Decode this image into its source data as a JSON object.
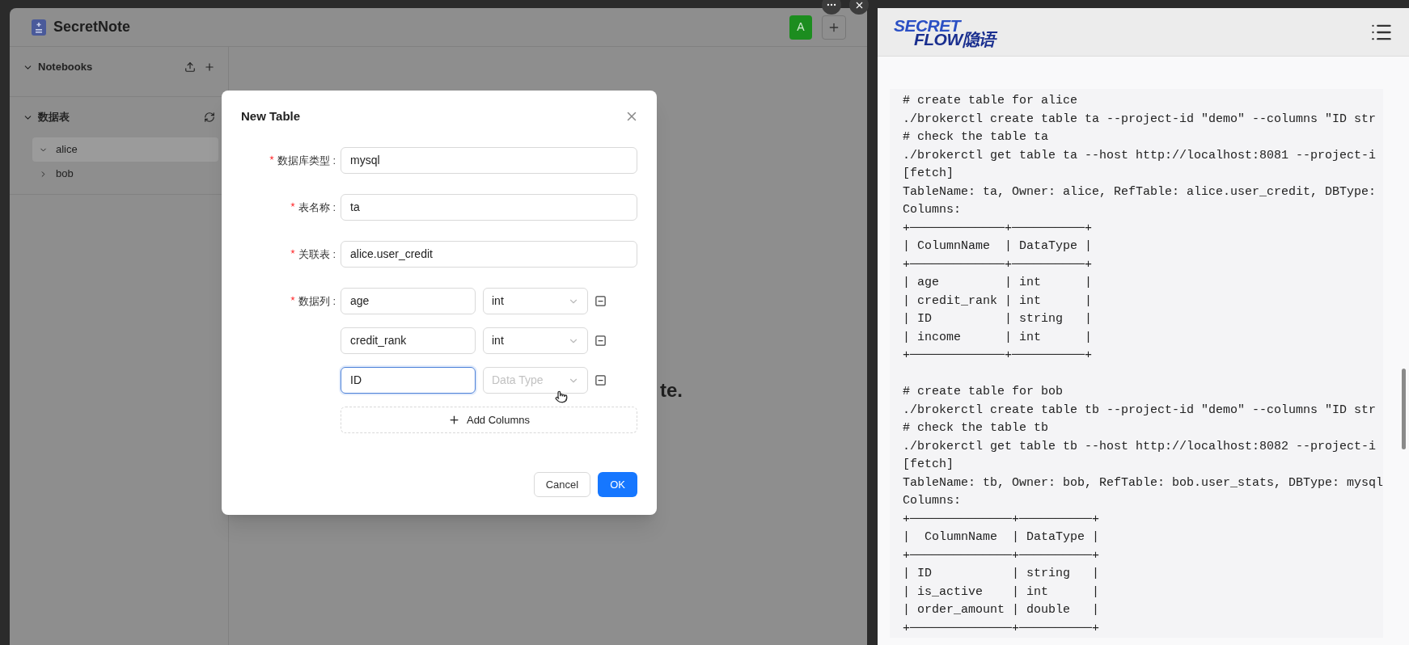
{
  "app": {
    "title": "SecretNote",
    "avatar": "A"
  },
  "sidebar": {
    "sections": [
      {
        "title": "Notebooks",
        "kind": "notebooks",
        "expanded": true
      },
      {
        "title": "数据表",
        "kind": "tables",
        "expanded": true,
        "items": [
          {
            "label": "alice",
            "expanded": true,
            "selected": true
          },
          {
            "label": "bob",
            "expanded": false,
            "selected": false
          }
        ]
      }
    ]
  },
  "main": {
    "text": "te."
  },
  "dialog": {
    "title": "New Table",
    "fields": [
      {
        "label": "数据库类型 :",
        "required": true,
        "value": "mysql"
      },
      {
        "label": "表名称 :",
        "required": true,
        "value": "ta"
      },
      {
        "label": "关联表 :",
        "required": true,
        "value": "alice.user_credit"
      }
    ],
    "columns": {
      "label": "数据列 :",
      "required": true,
      "rows": [
        {
          "name": "age",
          "type": "int",
          "focused": false
        },
        {
          "name": "credit_rank",
          "type": "int",
          "focused": false
        },
        {
          "name": "ID",
          "placeholder": "Data Type",
          "focused": true
        }
      ]
    },
    "add_button": "Add Columns",
    "buttons": [
      {
        "label": "Cancel",
        "kind": "secondary"
      },
      {
        "label": "OK",
        "kind": "primary"
      }
    ]
  },
  "docs": {
    "logo": [
      "SECRET",
      "FLOW隐语"
    ],
    "code_blocks": [
      [
        "# create table for alice",
        "./brokerctl create table ta --project-id \"demo\" --columns \"ID str",
        "# check the table ta",
        "./brokerctl get table ta --host http://localhost:8081 --project-i",
        "[fetch]",
        "TableName: ta, Owner: alice, RefTable: alice.user_credit, DBType:",
        "Columns:",
        "+─────────────+──────────+",
        "| ColumnName  | DataType |",
        "+─────────────+──────────+",
        "| age         | int      |",
        "| credit_rank | int      |",
        "| ID          | string   |",
        "| income      | int      |",
        "+─────────────+──────────+"
      ],
      [
        "# create table for bob",
        "./brokerctl create table tb --project-id \"demo\" --columns \"ID str",
        "# check the table tb",
        "./brokerctl get table tb --host http://localhost:8082 --project-i",
        "[fetch]",
        "TableName: tb, Owner: bob, RefTable: bob.user_stats, DBType: mysql",
        "Columns:",
        "+──────────────+──────────+",
        "|  ColumnName  | DataType |",
        "+──────────────+──────────+",
        "| ID           | string   |",
        "| is_active    | int      |",
        "| order_amount | double   |",
        "+──────────────+──────────+"
      ]
    ]
  }
}
